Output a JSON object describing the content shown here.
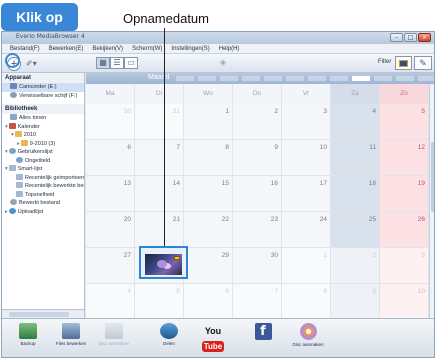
{
  "callouts": {
    "klik_op": "Klik op",
    "opnamedatum": "Opnamedatum"
  },
  "window": {
    "title": "Everio MediaBrowser 4",
    "min_glyph": "–",
    "max_glyph": "□",
    "close_glyph": "×"
  },
  "menu": {
    "items": [
      "Bestand(F)",
      "Bewerken(E)",
      "Bekijken(V)",
      "Scherm(W)",
      "Instellingen(S)",
      "Help(H)"
    ]
  },
  "toolbar": {
    "add_glyph": "+",
    "tools_glyph": "✐▾",
    "view_glyphs": [
      "▦",
      "☰",
      "▭"
    ],
    "filter_label": "Filter"
  },
  "sidebar": {
    "device_header": "Apparaat",
    "devices": [
      {
        "label": "Camcorder (E:)",
        "icon": "camcorder-icon",
        "selected": true
      },
      {
        "label": "Verwisselbare schijf (F:)",
        "icon": "removable-disk-icon",
        "selected": false
      }
    ],
    "library_header": "Bibliotheek",
    "library": [
      {
        "label": "Alles tonen",
        "indent": 0,
        "icon": "photos-icon",
        "arrow": ""
      },
      {
        "label": "Kalender",
        "indent": 0,
        "icon": "calendar-icon",
        "arrow": "▾"
      },
      {
        "label": "2010",
        "indent": 1,
        "icon": "folder-icon",
        "arrow": "▾"
      },
      {
        "label": "9-2010 (3)",
        "indent": 2,
        "icon": "folder-icon",
        "arrow": "▸"
      },
      {
        "label": "Gebruikerslijst",
        "indent": 0,
        "icon": "user-list-icon",
        "arrow": "▾"
      },
      {
        "label": "Ongetiteld",
        "indent": 1,
        "icon": "user-icon",
        "arrow": ""
      },
      {
        "label": "Smart-lijst",
        "indent": 0,
        "icon": "smart-list-icon",
        "arrow": "▾"
      },
      {
        "label": "Recentelijk geimporteerd",
        "indent": 1,
        "icon": "smart-list-icon",
        "arrow": ""
      },
      {
        "label": "Recentelijk bewerkte bestanden",
        "indent": 1,
        "icon": "smart-list-icon",
        "arrow": ""
      },
      {
        "label": "Topsnelheid",
        "indent": 1,
        "icon": "smart-list-icon",
        "arrow": ""
      },
      {
        "label": "Bewerkt bestand",
        "indent": 0,
        "icon": "edited-file-icon",
        "arrow": ""
      },
      {
        "label": "Uploadlijst",
        "indent": 0,
        "icon": "upload-list-icon",
        "arrow": "▸"
      }
    ]
  },
  "calendar": {
    "month_label": "Maand",
    "weekdays": [
      "Ma",
      "Di",
      "Wo",
      "Do",
      "Vr",
      "Za",
      "Zo"
    ],
    "weeks": [
      [
        "30",
        "31",
        "1",
        "2",
        "3",
        "4",
        "5"
      ],
      [
        "6",
        "7",
        "8",
        "9",
        "10",
        "11",
        "12"
      ],
      [
        "13",
        "14",
        "15",
        "16",
        "17",
        "18",
        "19"
      ],
      [
        "20",
        "21",
        "22",
        "23",
        "24",
        "25",
        "26"
      ],
      [
        "27",
        "28",
        "29",
        "30",
        "1",
        "2",
        "3"
      ],
      [
        "4",
        "5",
        "6",
        "7",
        "8",
        "9",
        "10"
      ]
    ]
  },
  "bottom_toolbar": {
    "buttons": [
      {
        "label": "Backup",
        "icon": "backup-icon",
        "enabled": true
      },
      {
        "label": "Files bewerken",
        "icon": "edit-files-icon",
        "enabled": true
      },
      {
        "label": "Disc aanmaken",
        "icon": "disc-icon",
        "enabled": false
      },
      {
        "label": "Delen",
        "icon": "share-icon",
        "enabled": true
      },
      {
        "label": "",
        "icon": "youtube-icon",
        "enabled": true
      },
      {
        "label": "",
        "icon": "facebook-icon",
        "enabled": true
      },
      {
        "label": "Disc aanmaken",
        "icon": "create-disc-icon",
        "enabled": true
      }
    ],
    "youtube_you": "You",
    "youtube_tube": "Tube",
    "facebook_glyph": "f"
  },
  "colors": {
    "callout_blue": "#3a87d8",
    "selected_border": "#2c84d7",
    "sunday_red": "#c94e5f"
  }
}
